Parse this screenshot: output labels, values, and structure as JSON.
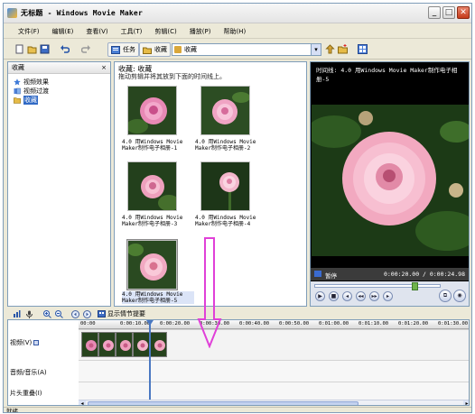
{
  "window": {
    "title": "无标题 - Windows Movie Maker",
    "controls": {
      "minimize": "_",
      "maximize": "□",
      "close": "✕"
    }
  },
  "menu": [
    "文件(F)",
    "编辑(E)",
    "查看(V)",
    "工具(T)",
    "剪辑(C)",
    "播放(P)",
    "帮助(H)"
  ],
  "toolbar": {
    "tasks_label": "任务",
    "collections_label": "收藏",
    "location_value": "收藏",
    "icons": [
      "new-icon",
      "open-icon",
      "save-icon",
      "undo-icon",
      "redo-icon"
    ]
  },
  "tree": {
    "header": "收藏",
    "close": "×",
    "items": [
      {
        "label": "视频效果",
        "icon": "star-icon"
      },
      {
        "label": "视频过渡",
        "icon": "transition-icon"
      },
      {
        "label": "收藏",
        "icon": "folder-icon",
        "selected": true
      }
    ]
  },
  "collection": {
    "title": "收藏: 收藏",
    "hint": "拖动剪辑并将其放到下面的时间线上。",
    "items": [
      {
        "caption1": "4.0 用Windows Movie",
        "caption2": "Maker制作电子相册-1"
      },
      {
        "caption1": "4.0 用Windows Movie",
        "caption2": "Maker制作电子相册-2"
      },
      {
        "caption1": "4.0 用Windows Movie",
        "caption2": "Maker制作电子相册-3"
      },
      {
        "caption1": "4.0 用Windows Movie",
        "caption2": "Maker制作电子相册-4"
      },
      {
        "caption1": "4.0 用Windows Movie",
        "caption2": "Maker制作电子相册-5",
        "selected": true
      }
    ]
  },
  "monitor": {
    "title": "时间线: 4.0 用Windows Movie Maker制作电子相册-5",
    "state": "暂停",
    "time": "0:00:20.00 / 0:00:24.98",
    "progress": 0.8
  },
  "timeline": {
    "storyboard_label": "显示情节提要",
    "ruler": [
      "00:00",
      "0:00:10.00",
      "0:00:20.00",
      "0:00:30.00",
      "0:00:40.00",
      "0:00:50.00",
      "0:01:00.00",
      "0:01:10.00",
      "0:01:20.00",
      "0:01:30.00"
    ],
    "tracks": {
      "video": "视频(V)",
      "audio": "音频/音乐(A)",
      "title": "片头重叠(I)"
    },
    "clip_count": 5
  },
  "status": "就绪",
  "colors": {
    "annotation_arrow": "#e040d8",
    "selection": "#316ac5",
    "window_bg": "#ece9d8"
  }
}
